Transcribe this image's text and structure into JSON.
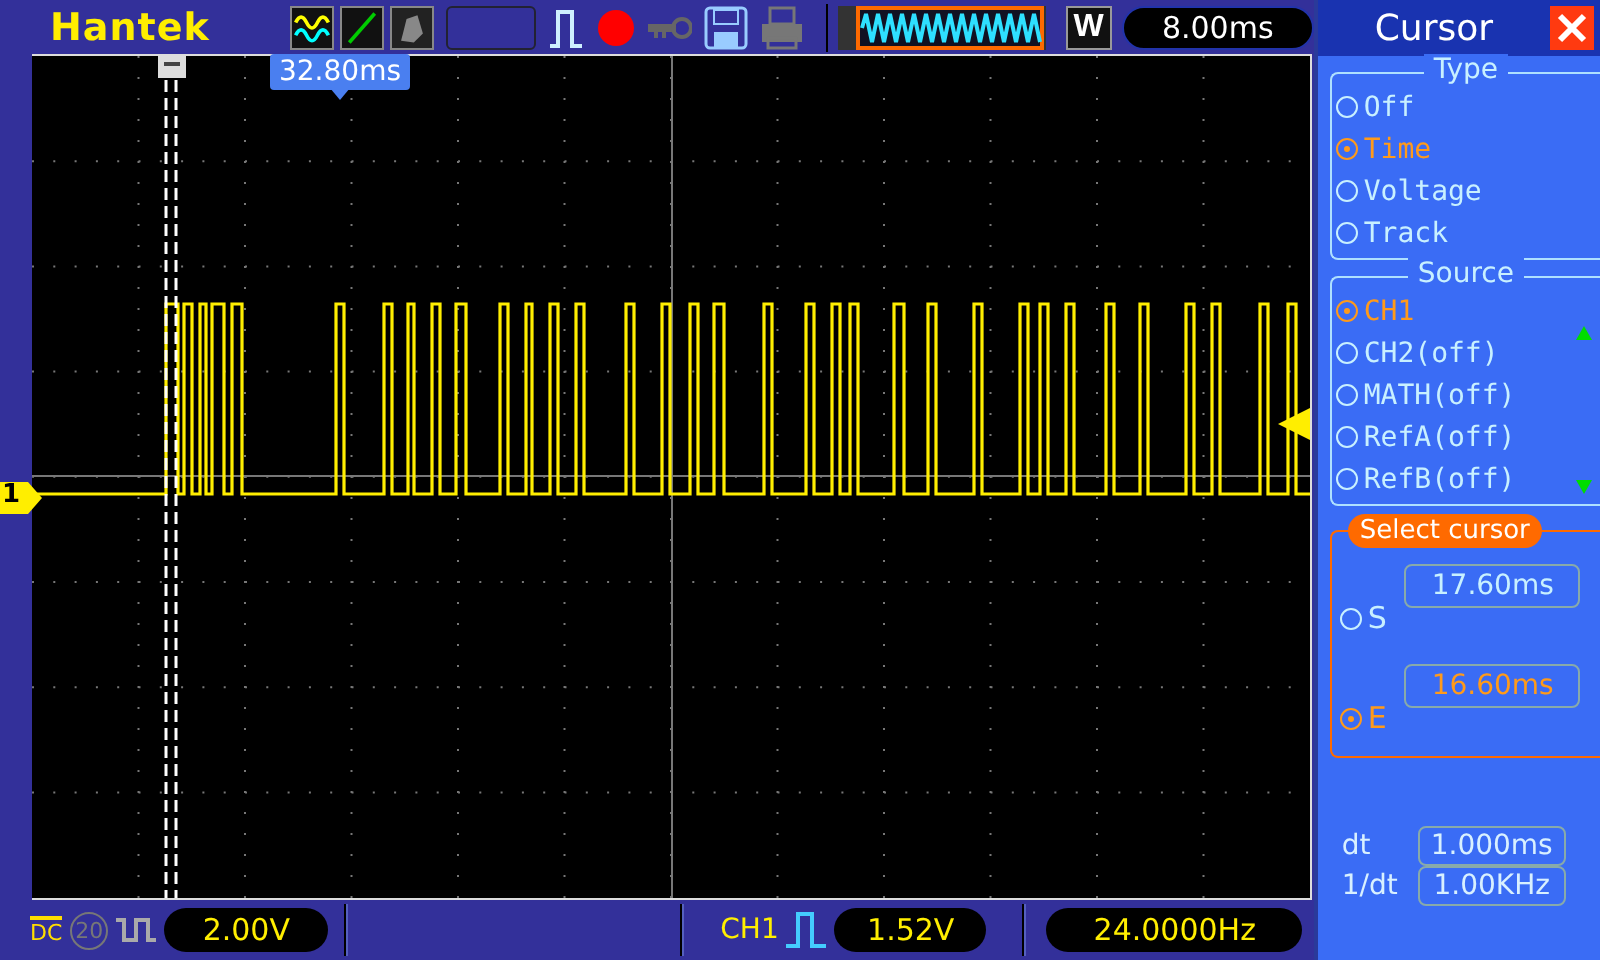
{
  "brand": "Hantek",
  "toolbar": {
    "mode": "W",
    "timebase": "8.00ms"
  },
  "scope": {
    "trigger_position": "32.80ms",
    "channel_marker": "1"
  },
  "panel": {
    "title": "Cursor",
    "type_group": {
      "legend": "Type",
      "options": [
        {
          "label": "Off",
          "selected": false
        },
        {
          "label": "Time",
          "selected": true
        },
        {
          "label": "Voltage",
          "selected": false
        },
        {
          "label": "Track",
          "selected": false
        }
      ]
    },
    "source_group": {
      "legend": "Source",
      "options": [
        {
          "label": "CH1",
          "selected": true
        },
        {
          "label": "CH2(off)",
          "selected": false
        },
        {
          "label": "MATH(off)",
          "selected": false
        },
        {
          "label": "RefA(off)",
          "selected": false
        },
        {
          "label": "RefB(off)",
          "selected": false
        }
      ]
    },
    "select_group": {
      "legend": "Select cursor",
      "cursors": [
        {
          "label": "S",
          "value": "17.60ms",
          "selected": false
        },
        {
          "label": "E",
          "value": "16.60ms",
          "selected": true
        }
      ]
    },
    "readouts": [
      {
        "label": "dt",
        "value": "1.000ms"
      },
      {
        "label": "1/dt",
        "value": "1.00KHz"
      }
    ]
  },
  "status_bar": {
    "coupling": "DC",
    "bw_limit": {
      "label": "20",
      "on": false
    },
    "ch1_scale": "2.00V",
    "trigger_source": "CH1",
    "trigger_level": "1.52V",
    "frequency": "24.0000Hz"
  }
}
